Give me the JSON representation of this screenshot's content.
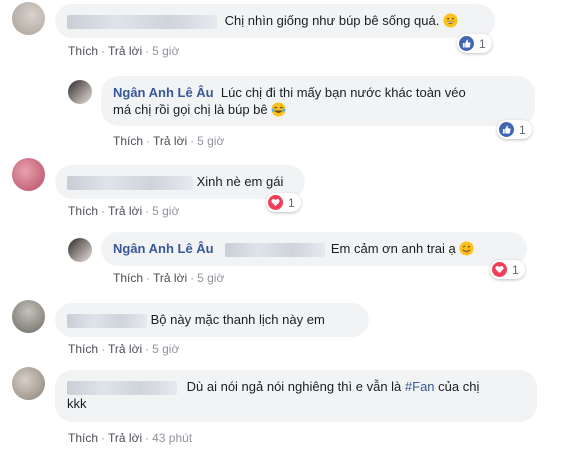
{
  "actions": {
    "like": "Thích",
    "reply": "Trả lời",
    "dot": "·"
  },
  "comments": [
    {
      "text": "Chị nhìn giống như búp bê sống quá.",
      "time": "5 giờ",
      "reaction_count": "1",
      "reaction_icon": "like-icon"
    },
    {
      "author": "Ngân Anh Lê Âu",
      "text_line1": "Lúc chị đi thi mấy bạn nước khác toàn véo",
      "text_line2": "má chị rồi gọi chị là búp bê",
      "time": "5 giờ",
      "reaction_count": "1",
      "reaction_icon": "like-icon"
    },
    {
      "text": "Xinh nè em gái",
      "time": "5 giờ",
      "reaction_count": "1",
      "reaction_icon": "heart-icon"
    },
    {
      "author": "Ngân Anh Lê Âu",
      "text": "Em cảm ơn anh trai ạ",
      "time": "5 giờ",
      "reaction_count": "1",
      "reaction_icon": "heart-icon"
    },
    {
      "text": "Bộ này mặc thanh lịch này em",
      "time": "5 giờ"
    },
    {
      "text_pre": "Dù ai nói ngả nói nghiêng thì e vẫn là ",
      "hashtag": "#Fan",
      "text_post": " của chị",
      "text_line2": "kkk",
      "time": "43 phút"
    }
  ],
  "colors": {
    "link_blue": "#385898",
    "bubble_bg": "#f2f3f5",
    "like_blue": "#4267b2",
    "love_red": "#f33e58"
  }
}
